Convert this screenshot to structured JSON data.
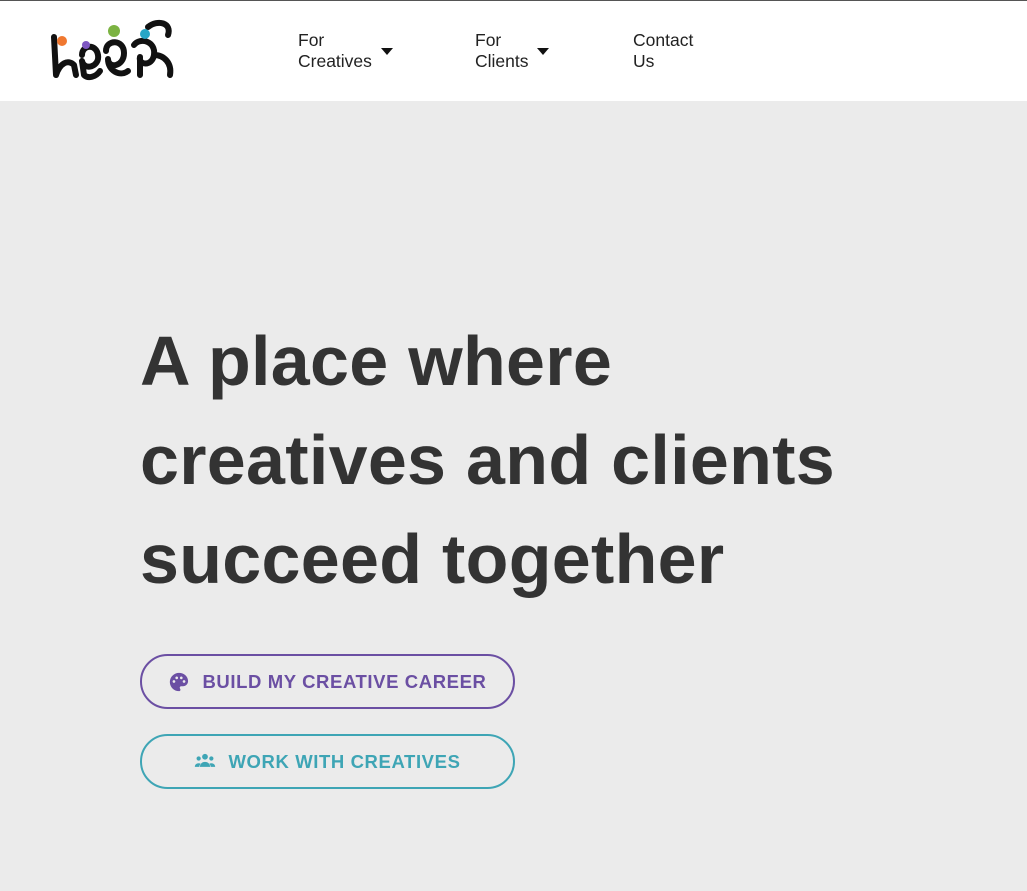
{
  "nav": {
    "items": [
      {
        "label": "For Creatives",
        "has_dropdown": true
      },
      {
        "label": "For Clients",
        "has_dropdown": true
      },
      {
        "label": "Contact Us",
        "has_dropdown": false
      }
    ]
  },
  "hero": {
    "title_lines": [
      "A place where",
      "creatives and clients",
      "succeed together"
    ]
  },
  "buttons": {
    "creative": {
      "label": "BUILD MY CREATIVE CAREER",
      "icon": "palette-icon",
      "color": "#6b4fa3"
    },
    "clients": {
      "label": "WORK WITH CREATIVES",
      "icon": "users-icon",
      "color": "#3ea5b5"
    }
  },
  "colors": {
    "background": "#ebebeb",
    "header": "#ffffff",
    "title": "#333333",
    "logo_orange": "#f07830",
    "logo_green": "#7cb342",
    "logo_purple": "#7e57c2",
    "logo_teal": "#26a6c6"
  }
}
